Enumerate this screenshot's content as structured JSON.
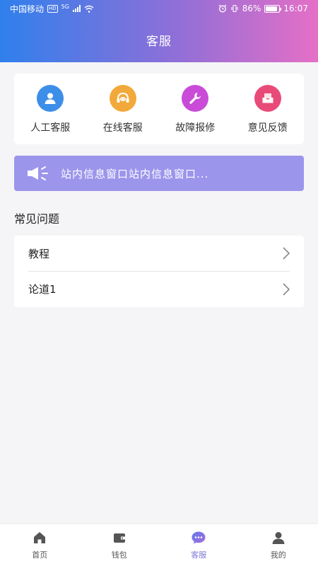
{
  "status_bar": {
    "carrier": "中国移动",
    "hd_badge": "HD",
    "network": "5G",
    "battery": "86%",
    "battery_level": 0.86,
    "time": "16:07"
  },
  "header": {
    "title": "客服"
  },
  "quick_actions": [
    {
      "label": "人工客服",
      "icon": "person-icon",
      "color": "#3d8ee8"
    },
    {
      "label": "在线客服",
      "icon": "headset-icon",
      "color": "#f2a93b"
    },
    {
      "label": "故障报修",
      "icon": "wrench-icon",
      "color": "#c94bd8"
    },
    {
      "label": "意见反馈",
      "icon": "mailbox-icon",
      "color": "#e94b78"
    }
  ],
  "notice": {
    "text": "站内信息窗口站内信息窗口..."
  },
  "faq": {
    "title": "常见问题",
    "items": [
      {
        "label": "教程"
      },
      {
        "label": "论道1"
      }
    ]
  },
  "bottom_nav": {
    "items": [
      {
        "label": "首页",
        "icon": "home-icon"
      },
      {
        "label": "钱包",
        "icon": "wallet-icon"
      },
      {
        "label": "客服",
        "icon": "chat-icon",
        "active": true
      },
      {
        "label": "我的",
        "icon": "profile-icon"
      }
    ],
    "active_color": "#7a78d6"
  }
}
